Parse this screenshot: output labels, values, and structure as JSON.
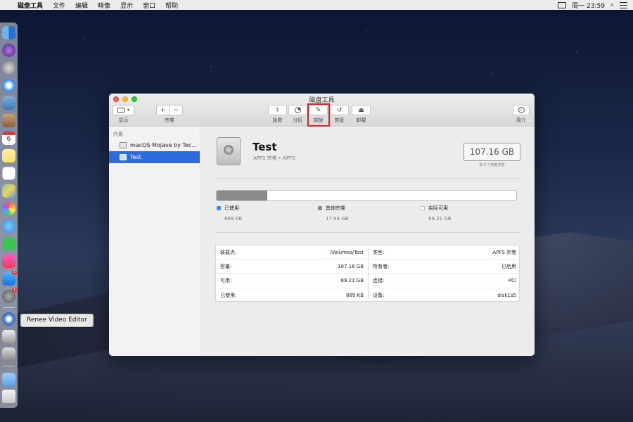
{
  "menubar": {
    "app_name": "磁盘工具",
    "items": [
      "文件",
      "编辑",
      "映像",
      "显示",
      "窗口",
      "帮助"
    ],
    "clock": "周一 23:59"
  },
  "dock": {
    "tooltip": "Renee Video Editor",
    "calendar_day": "6",
    "badge_appstore": "1",
    "badge_prefs": "1"
  },
  "window": {
    "title": "磁盘工具",
    "toolbar": {
      "view_label": "显示",
      "volume_label": "宗卷",
      "first_aid_label": "急救",
      "partition_label": "分区",
      "erase_label": "抹掉",
      "restore_label": "恢复",
      "unmount_label": "卸载",
      "info_label": "简介",
      "add_symbol": "+",
      "remove_symbol": "−"
    },
    "sidebar": {
      "section": "内置",
      "items": [
        {
          "label": "macOS Mojave by Tec..."
        },
        {
          "label": "Test"
        }
      ]
    },
    "volume": {
      "name": "Test",
      "subtitle": "APFS 宗卷 • APFS",
      "capacity": "107.16 GB",
      "capacity_note": "由 5 个宗卷共享"
    },
    "usage": {
      "used_fraction": 0.17,
      "legend": [
        {
          "label": "已使用",
          "value": "889 KB",
          "color": "#3a8ef0"
        },
        {
          "label": "其他宗卷",
          "value": "17.94 GB",
          "color": "#8c8c8c"
        },
        {
          "label": "实际可用",
          "value": "89.21 GB",
          "color": "#ffffff"
        }
      ]
    },
    "info_left": [
      {
        "key": "装载点:",
        "value": "/Volumes/Test"
      },
      {
        "key": "容量:",
        "value": "107.16 GB"
      },
      {
        "key": "可用:",
        "value": "89.21 GB"
      },
      {
        "key": "已使用:",
        "value": "889 KB"
      }
    ],
    "info_right": [
      {
        "key": "类型:",
        "value": "APFS 宗卷"
      },
      {
        "key": "所有者:",
        "value": "已启用"
      },
      {
        "key": "连接:",
        "value": "PCI"
      },
      {
        "key": "设备:",
        "value": "disk1s5"
      }
    ]
  }
}
